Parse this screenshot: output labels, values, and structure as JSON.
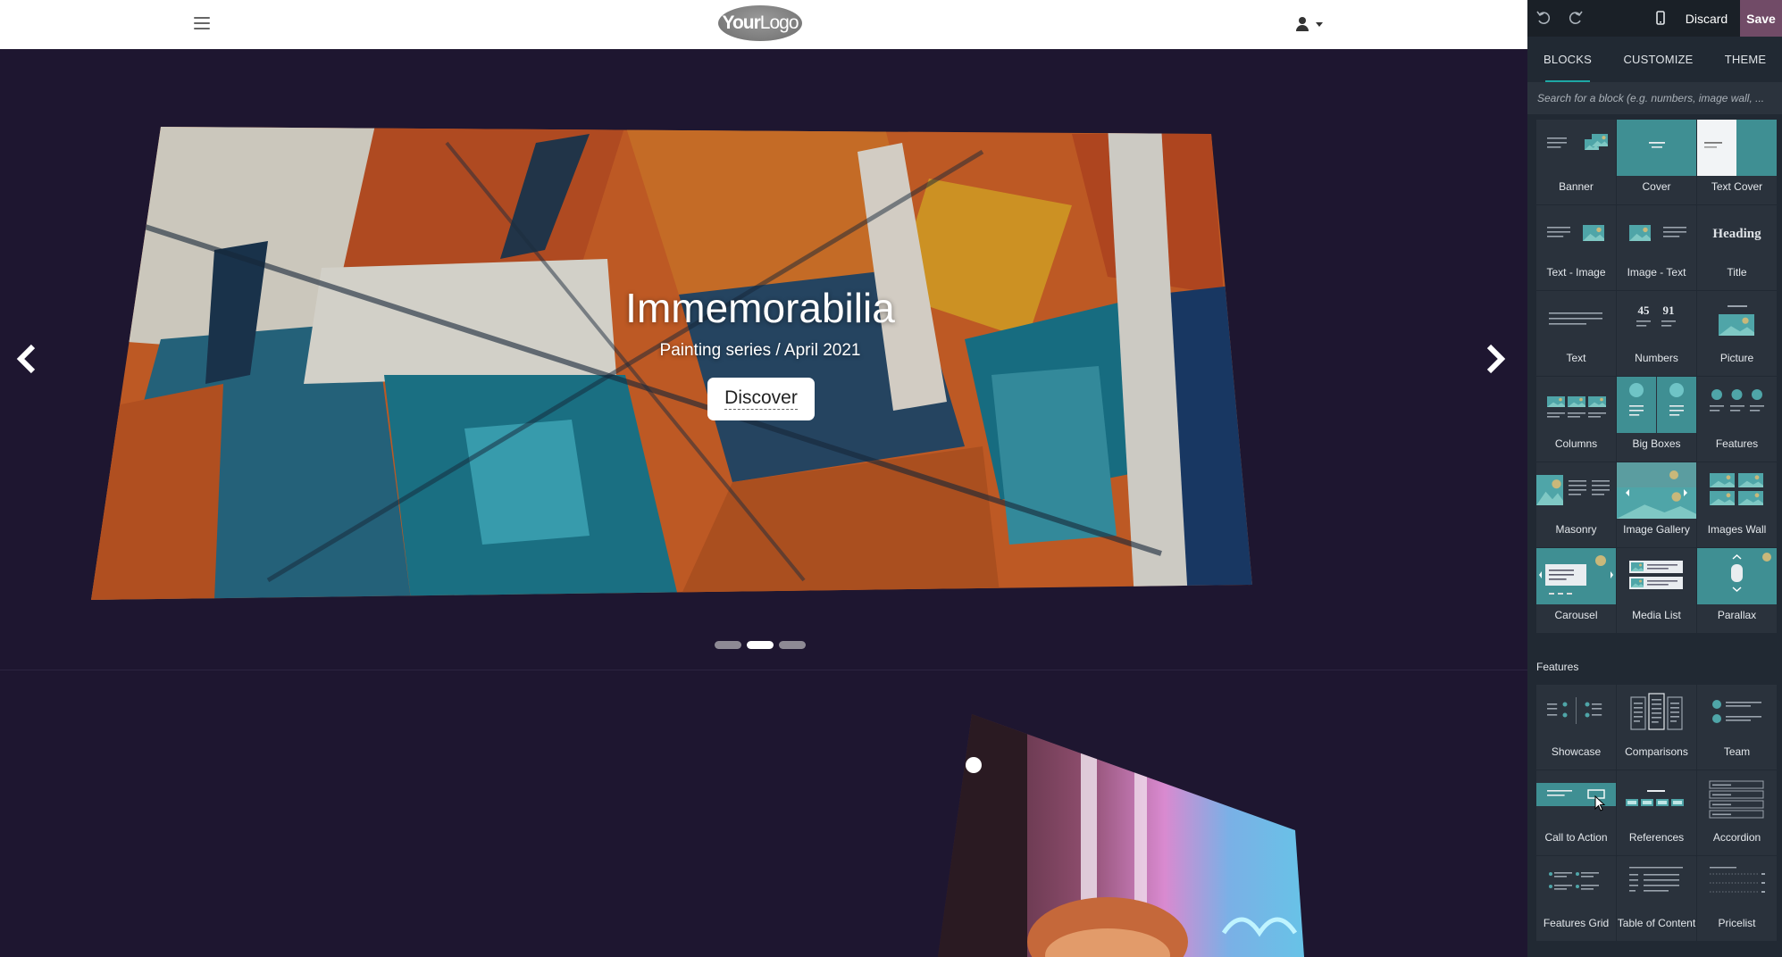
{
  "site": {
    "logo": {
      "bold": "Your",
      "light": "Logo"
    },
    "hero": {
      "title": "Immemorabilia",
      "subtitle": "Painting series / April 2021",
      "button_label": "Discover",
      "indicators": [
        {
          "active": false
        },
        {
          "active": true
        },
        {
          "active": false
        }
      ]
    }
  },
  "editor": {
    "toolbar": {
      "discard_label": "Discard",
      "save_label": "Save",
      "icons": [
        "undo-icon",
        "redo-icon",
        "mobile-icon"
      ]
    },
    "tabs": [
      {
        "label": "BLOCKS",
        "active": true
      },
      {
        "label": "CUSTOMIZE",
        "active": false
      },
      {
        "label": "THEME",
        "active": false
      }
    ],
    "search": {
      "placeholder": "Search for a block (e.g. numbers, image wall, ..."
    },
    "blocks": [
      {
        "label": "Banner",
        "thumb": "banner"
      },
      {
        "label": "Cover",
        "thumb": "cover"
      },
      {
        "label": "Text Cover",
        "thumb": "textcover"
      },
      {
        "label": "Text - Image",
        "thumb": "textimage"
      },
      {
        "label": "Image - Text",
        "thumb": "imagetext"
      },
      {
        "label": "Title",
        "thumb": "title"
      },
      {
        "label": "Text",
        "thumb": "text"
      },
      {
        "label": "Numbers",
        "thumb": "numbers"
      },
      {
        "label": "Picture",
        "thumb": "picture"
      },
      {
        "label": "Columns",
        "thumb": "columns"
      },
      {
        "label": "Big Boxes",
        "thumb": "bigboxes"
      },
      {
        "label": "Features",
        "thumb": "features"
      },
      {
        "label": "Masonry",
        "thumb": "masonry"
      },
      {
        "label": "Image Gallery",
        "thumb": "gallery"
      },
      {
        "label": "Images Wall",
        "thumb": "imageswall"
      },
      {
        "label": "Carousel",
        "thumb": "carousel"
      },
      {
        "label": "Media List",
        "thumb": "medialist"
      },
      {
        "label": "Parallax",
        "thumb": "parallax"
      }
    ],
    "features_section": {
      "title": "Features",
      "blocks": [
        {
          "label": "Showcase",
          "thumb": "showcase"
        },
        {
          "label": "Comparisons",
          "thumb": "comparisons"
        },
        {
          "label": "Team",
          "thumb": "team"
        },
        {
          "label": "Call to Action",
          "thumb": "cta"
        },
        {
          "label": "References",
          "thumb": "references"
        },
        {
          "label": "Accordion",
          "thumb": "accordion"
        },
        {
          "label": "Features Grid",
          "thumb": "featuresgrid"
        },
        {
          "label": "Table of Content",
          "thumb": "toc"
        },
        {
          "label": "Pricelist",
          "thumb": "pricelist"
        }
      ]
    },
    "thumb_text": {
      "heading": "Heading",
      "n1": "45",
      "n2": "91"
    }
  },
  "colors": {
    "accent": "#1ea8a5",
    "save": "#714b67",
    "panel": "#212933",
    "site_bg": "#1e1630"
  }
}
